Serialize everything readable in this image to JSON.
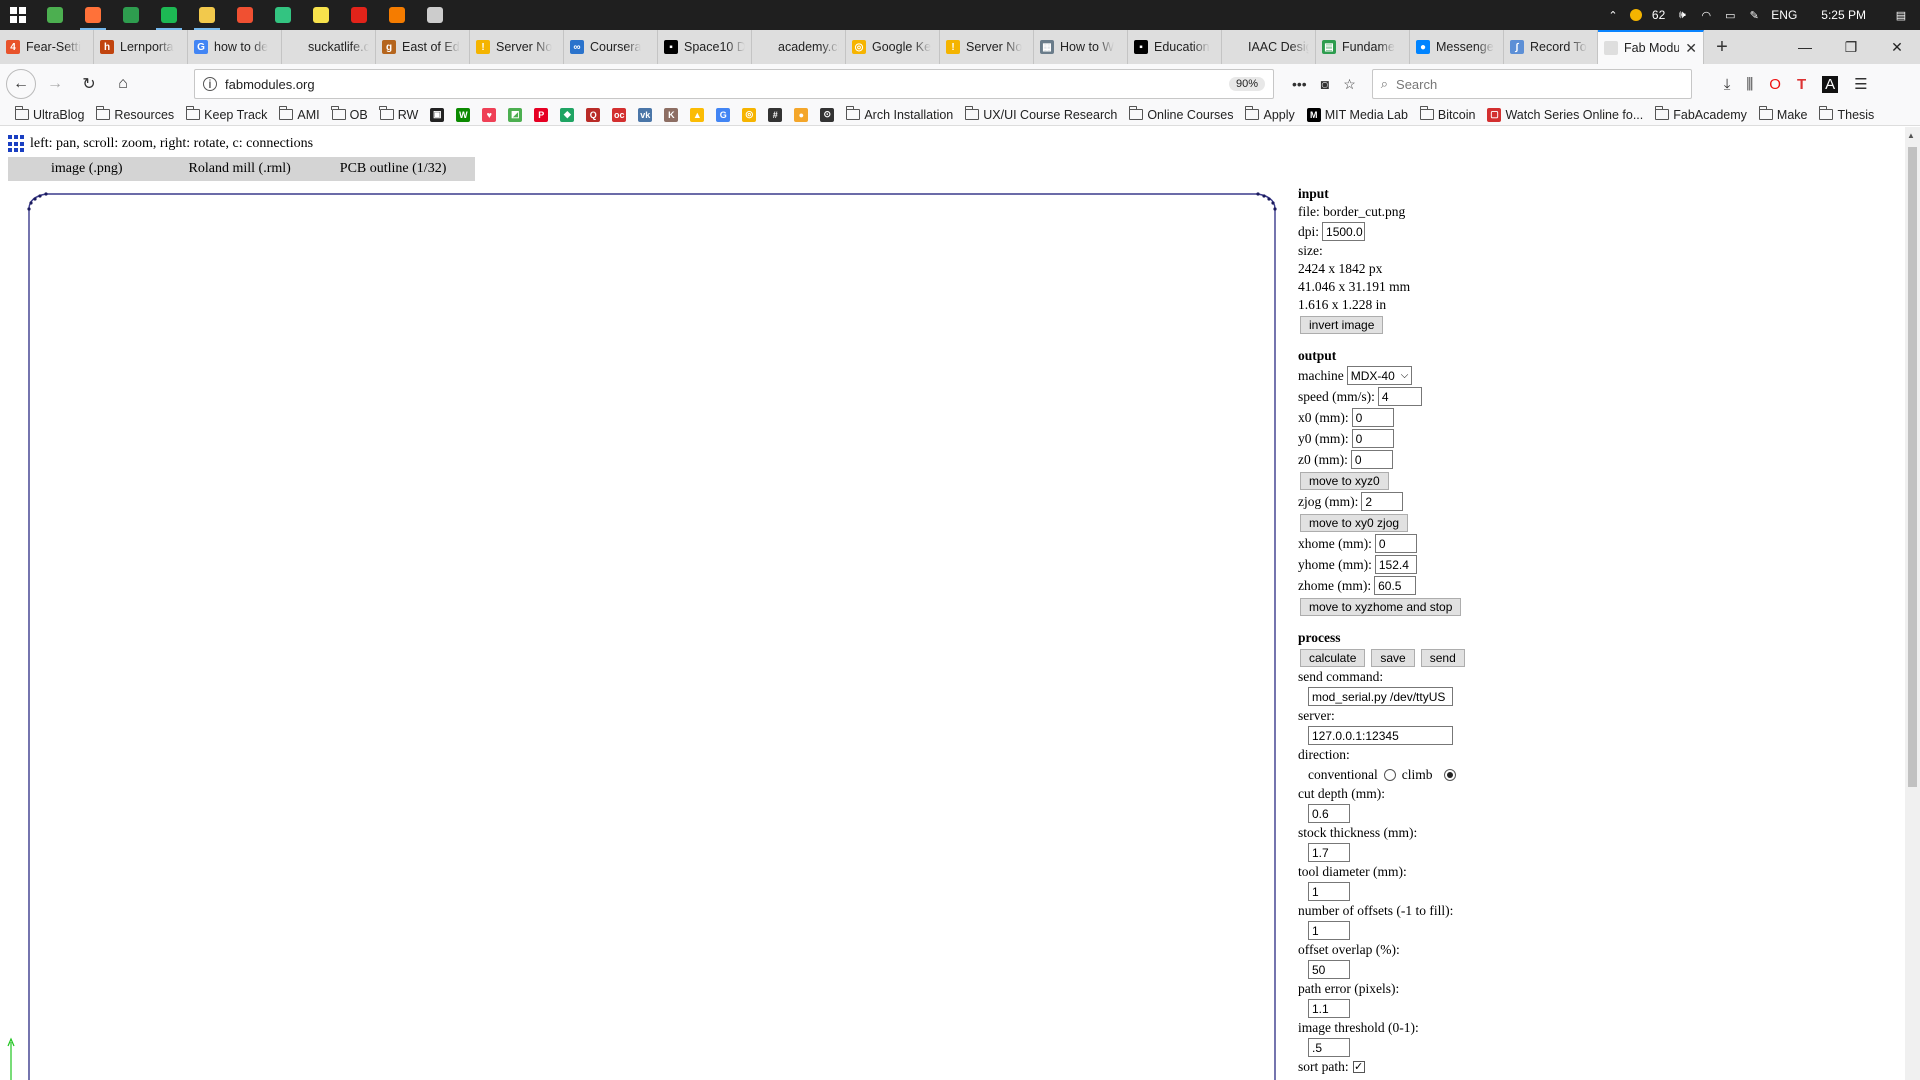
{
  "taskbar": {
    "apps": [
      {
        "name": "calculator-app",
        "color": "#4caf50",
        "open": false
      },
      {
        "name": "firefox-app",
        "color": "#ff7139",
        "open": true
      },
      {
        "name": "xbox-app",
        "color": "#2e9d4f",
        "open": false
      },
      {
        "name": "spotify-app",
        "color": "#1db954",
        "open": true
      },
      {
        "name": "file-explorer-app",
        "color": "#f2c94c",
        "open": true
      },
      {
        "name": "git-app",
        "color": "#f05032",
        "open": false
      },
      {
        "name": "chat-app",
        "color": "#33c481",
        "open": false
      },
      {
        "name": "sticky-notes-app",
        "color": "#f7e24c",
        "open": false
      },
      {
        "name": "acrobat-app",
        "color": "#e2231a",
        "open": false
      },
      {
        "name": "letter-e-app",
        "color": "#f57c00",
        "open": false
      },
      {
        "name": "mask-app",
        "color": "#cccccc",
        "open": false
      }
    ],
    "tray": {
      "weather_value": "62",
      "language": "ENG",
      "time": "5:25 PM"
    }
  },
  "tabs": [
    {
      "title": "Fear-Setti",
      "fav_color": "#e8532b",
      "fav_char": "4"
    },
    {
      "title": "Lernporta",
      "fav_color": "#c1440e",
      "fav_char": "h"
    },
    {
      "title": "how to de",
      "fav_color": "#4285f4",
      "fav_char": "G"
    },
    {
      "title": "suckatlife.com",
      "fav_color": "#dedede",
      "fav_char": ""
    },
    {
      "title": "East of Ed",
      "fav_color": "#b5651d",
      "fav_char": "g"
    },
    {
      "title": "Server No",
      "fav_color": "#f4b400",
      "fav_char": "!"
    },
    {
      "title": "Coursera",
      "fav_color": "#2a73cc",
      "fav_char": "∞"
    },
    {
      "title": "Space10 D",
      "fav_color": "#000000",
      "fav_char": "▪"
    },
    {
      "title": "academy.cba.",
      "fav_color": "#dedede",
      "fav_char": ""
    },
    {
      "title": "Google Ke",
      "fav_color": "#f6b400",
      "fav_char": "◎"
    },
    {
      "title": "Server No",
      "fav_color": "#f4b400",
      "fav_char": "!"
    },
    {
      "title": "How to W",
      "fav_color": "#6a7c8a",
      "fav_char": "▦"
    },
    {
      "title": "Education",
      "fav_color": "#000000",
      "fav_char": "▪"
    },
    {
      "title": "IAAC Designs",
      "fav_color": "#dedede",
      "fav_char": ""
    },
    {
      "title": "Fundame",
      "fav_color": "#2e9d4f",
      "fav_char": "▤"
    },
    {
      "title": "Messenge",
      "fav_color": "#0084ff",
      "fav_char": "●"
    },
    {
      "title": "Record To",
      "fav_color": "#5c8fd6",
      "fav_char": "∫"
    },
    {
      "title": "Fab Modu",
      "fav_color": "#dedede",
      "fav_char": "",
      "active": true
    }
  ],
  "nav": {
    "url": "fabmodules.org",
    "zoom": "90%",
    "search_placeholder": "Search"
  },
  "bookmarks": [
    {
      "type": "folder",
      "label": "UltraBlog"
    },
    {
      "type": "folder",
      "label": "Resources"
    },
    {
      "type": "folder",
      "label": "Keep Track"
    },
    {
      "type": "folder",
      "label": "AMI"
    },
    {
      "type": "folder",
      "label": "OB"
    },
    {
      "type": "folder",
      "label": "RW"
    },
    {
      "type": "icon",
      "label": "",
      "color": "#222222",
      "char": "▣"
    },
    {
      "type": "icon",
      "label": "",
      "color": "#0b8a00",
      "char": "W"
    },
    {
      "type": "icon",
      "label": "",
      "color": "#ef4056",
      "char": "♥"
    },
    {
      "type": "icon",
      "label": "",
      "color": "#4caf50",
      "char": "◩"
    },
    {
      "type": "icon",
      "label": "",
      "color": "#e60023",
      "char": "P"
    },
    {
      "type": "icon",
      "label": "",
      "color": "#1fa463",
      "char": "◆"
    },
    {
      "type": "icon",
      "label": "",
      "color": "#b92b27",
      "char": "Q"
    },
    {
      "type": "icon",
      "label": "",
      "color": "#d32f2f",
      "char": "oc"
    },
    {
      "type": "icon",
      "label": "",
      "color": "#4a76a8",
      "char": "vk"
    },
    {
      "type": "icon",
      "label": "",
      "color": "#8d6e63",
      "char": "K"
    },
    {
      "type": "icon",
      "label": "",
      "color": "#fbbc04",
      "char": "▲"
    },
    {
      "type": "icon",
      "label": "",
      "color": "#4285f4",
      "char": "G"
    },
    {
      "type": "icon",
      "label": "",
      "color": "#f6b400",
      "char": "◎"
    },
    {
      "type": "icon",
      "label": "",
      "color": "#333333",
      "char": "#"
    },
    {
      "type": "icon",
      "label": "",
      "color": "#f4a62a",
      "char": "●"
    },
    {
      "type": "icon",
      "label": "",
      "color": "#333333",
      "char": "⊙"
    },
    {
      "type": "folder",
      "label": "Arch Installation"
    },
    {
      "type": "folder",
      "label": "UX/UI Course Research"
    },
    {
      "type": "folder",
      "label": "Online Courses"
    },
    {
      "type": "folder",
      "label": "Apply"
    },
    {
      "type": "icon",
      "label": "MIT Media Lab",
      "color": "#000000",
      "char": "M"
    },
    {
      "type": "folder",
      "label": "Bitcoin"
    },
    {
      "type": "icon",
      "label": "Watch Series Online fo...",
      "color": "#d32f2f",
      "char": "▢"
    },
    {
      "type": "folder",
      "label": "FabAcademy"
    },
    {
      "type": "folder",
      "label": "Make"
    },
    {
      "type": "folder",
      "label": "Thesis"
    }
  ],
  "page": {
    "hint": "left: pan, scroll: zoom, right: rotate, c: connections",
    "module_tabs": [
      "image (.png)",
      "Roland mill (.rml)",
      "PCB outline (1/32)"
    ],
    "input": {
      "heading": "input",
      "file": "file: border_cut.png",
      "dpi_label": "dpi:",
      "dpi_value": "1500.0",
      "size_label": "size:",
      "size_px": "2424 x 1842 px",
      "size_mm": "41.046 x 31.191 mm",
      "size_in": "1.616 x 1.228 in",
      "invert_button": "invert image"
    },
    "output": {
      "heading": "output",
      "machine_label": "machine",
      "machine_value": "MDX-40",
      "speed_label": "speed (mm/s):",
      "speed_value": "4",
      "x0_label": "x0 (mm):",
      "x0_value": "0",
      "y0_label": "y0 (mm):",
      "y0_value": "0",
      "z0_label": "z0 (mm):",
      "z0_value": "0",
      "move_xyz0_button": "move to xyz0",
      "zjog_label": "zjog (mm):",
      "zjog_value": "2",
      "move_xy0_zjog_button": "move to xy0 zjog",
      "xhome_label": "xhome (mm):",
      "xhome_value": "0",
      "yhome_label": "yhome (mm):",
      "yhome_value": "152.4",
      "zhome_label": "zhome (mm):",
      "zhome_value": "60.5",
      "move_home_button": "move to xyzhome and stop"
    },
    "process": {
      "heading": "process",
      "calculate_button": "calculate",
      "save_button": "save",
      "send_button": "send",
      "send_command_label": "send command:",
      "send_command_value": "mod_serial.py /dev/ttyUS",
      "server_label": "server:",
      "server_value": "127.0.0.1:12345",
      "direction_label": "direction:",
      "conventional_label": "conventional",
      "climb_label": "climb",
      "direction_selected": "climb",
      "cut_depth_label": "cut depth (mm):",
      "cut_depth_value": "0.6",
      "stock_thickness_label": "stock thickness (mm):",
      "stock_thickness_value": "1.7",
      "tool_diameter_label": "tool diameter (mm):",
      "tool_diameter_value": "1",
      "offsets_label": "number of offsets (-1 to fill):",
      "offsets_value": "1",
      "overlap_label": "offset overlap (%):",
      "overlap_value": "50",
      "path_error_label": "path error (pixels):",
      "path_error_value": "1.1",
      "threshold_label": "image threshold (0-1):",
      "threshold_value": ".5",
      "sort_path_label": "sort path:",
      "sort_path_checked": true
    }
  }
}
